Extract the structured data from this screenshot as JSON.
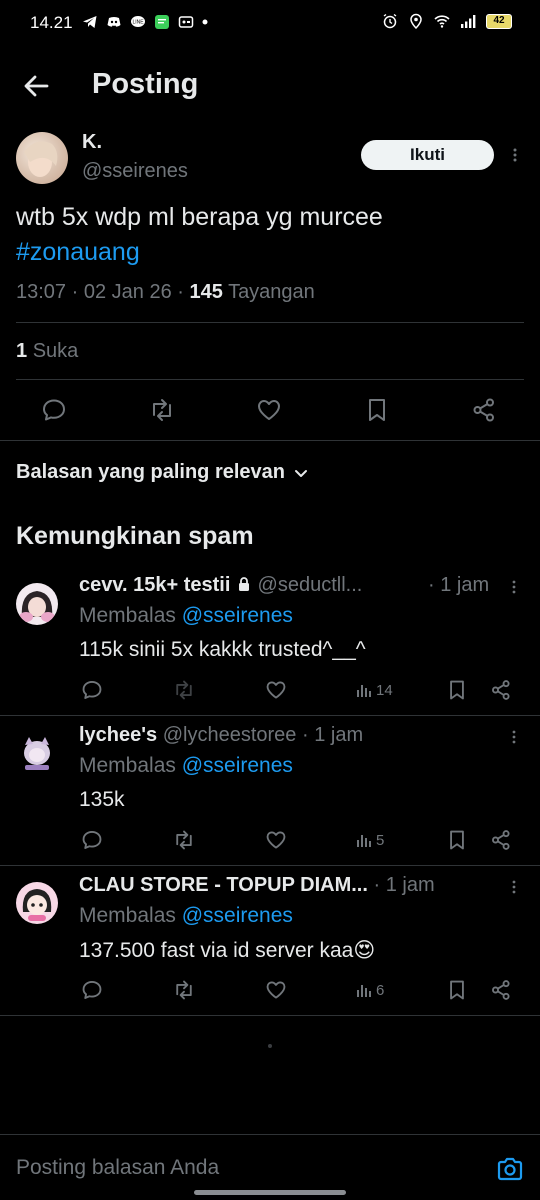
{
  "status_bar": {
    "time": "14.21",
    "battery": "42"
  },
  "header": {
    "title": "Posting"
  },
  "post": {
    "author_name": "K.",
    "author_handle": "@sseirenes",
    "follow_label": "Ikuti",
    "text": "wtb 5x wdp ml berapa yg murcee",
    "hashtag": "#zonauang",
    "time": "13:07",
    "date": "02 Jan 26",
    "views": "145",
    "views_label": "Tayangan",
    "likes_count": "1",
    "likes_label": "Suka"
  },
  "sort": {
    "label": "Balasan yang paling relevan"
  },
  "spam_heading": "Kemungkinan spam",
  "replies": [
    {
      "name": "cevv. 15k+ testii",
      "handle": "@seductll...",
      "time": "1 jam",
      "replying_prefix": "Membalas",
      "replying_to": "@sseirenes",
      "text": "115k sinii 5x kakkk trusted^__^",
      "views": "14"
    },
    {
      "name": "lychee's",
      "handle": "@lycheestoree",
      "time": "1 jam",
      "replying_prefix": "Membalas",
      "replying_to": "@sseirenes",
      "text": "135k",
      "views": "5"
    },
    {
      "name": "CLAU STORE - TOPUP DIAM...",
      "handle": "",
      "time": "1 jam",
      "replying_prefix": "Membalas",
      "replying_to": "@sseirenes",
      "text": "137.500 fast via id server kaa",
      "emoji": "😍",
      "views": "6"
    }
  ],
  "composer": {
    "placeholder": "Posting balasan Anda"
  },
  "colors": {
    "background": "#000000",
    "accent": "#1d9bf0",
    "secondary_text": "#71767b",
    "divider": "#2f3336"
  }
}
